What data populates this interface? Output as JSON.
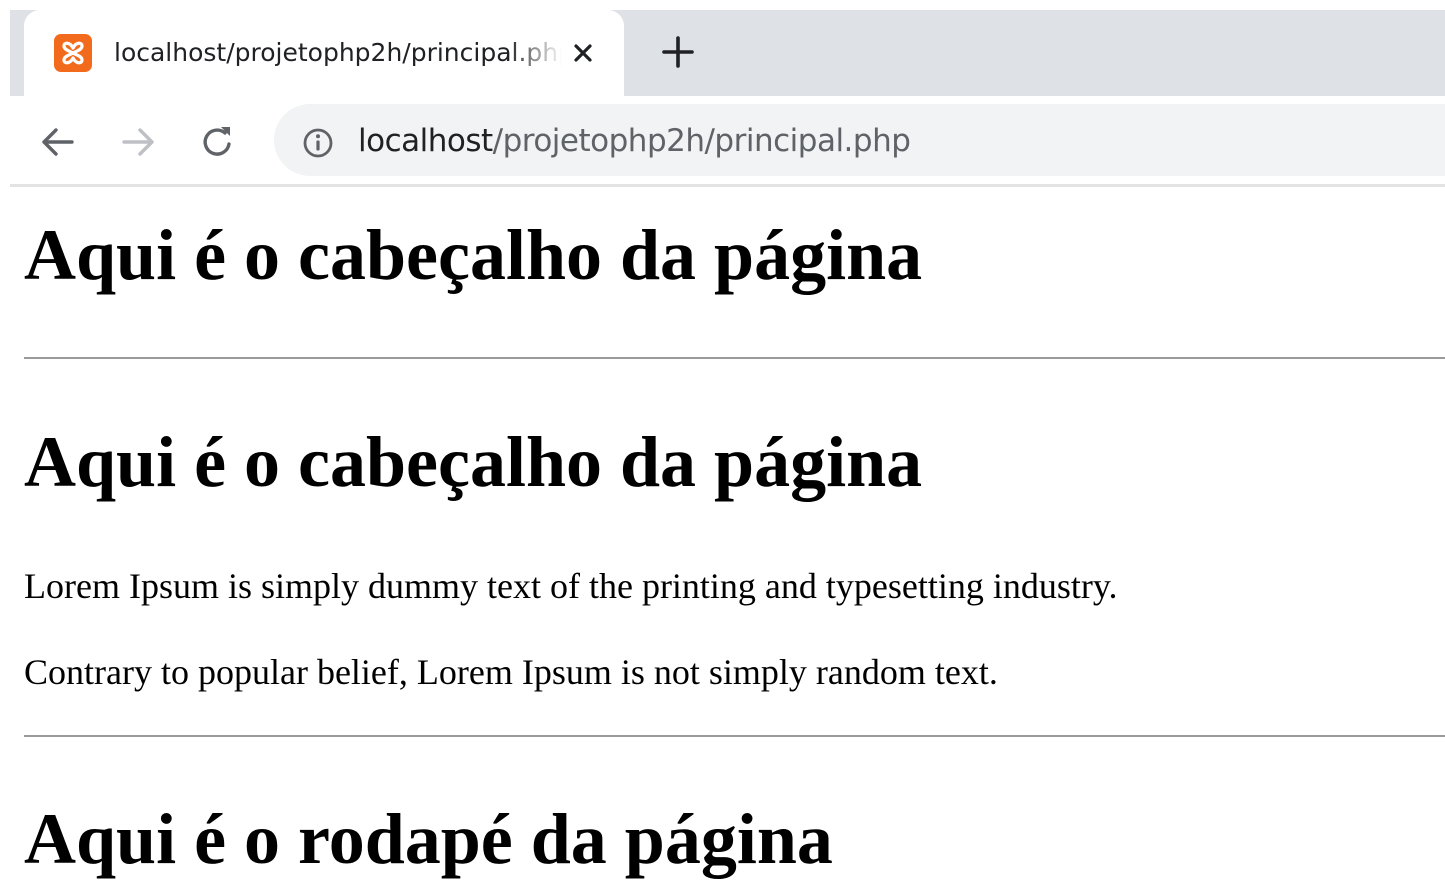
{
  "browser": {
    "tab": {
      "title": "localhost/projetophp2h/principal.php",
      "favicon": "xampp-icon",
      "close_icon": "close-icon"
    },
    "new_tab_icon": "plus-icon",
    "nav": {
      "back_icon": "arrow-left-icon",
      "forward_icon": "arrow-right-icon",
      "reload_icon": "reload-icon"
    },
    "address_bar": {
      "info_icon": "info-icon",
      "url_host": "localhost",
      "url_path": "/projetophp2h/principal.php"
    }
  },
  "page": {
    "header_title": "Aqui é o cabeçalho da página",
    "main_title": "Aqui é o cabeçalho da página",
    "paragraphs": [
      "Lorem Ipsum is simply dummy text of the printing and typesetting industry.",
      "Contrary to popular belief, Lorem Ipsum is not simply random text."
    ],
    "footer_title": "Aqui é o rodapé da página"
  },
  "colors": {
    "tabstrip_bg": "#dee1e6",
    "omnibox_bg": "#f1f3f4",
    "favicon_orange": "#f26b1d",
    "rule": "#9a9a9a"
  }
}
